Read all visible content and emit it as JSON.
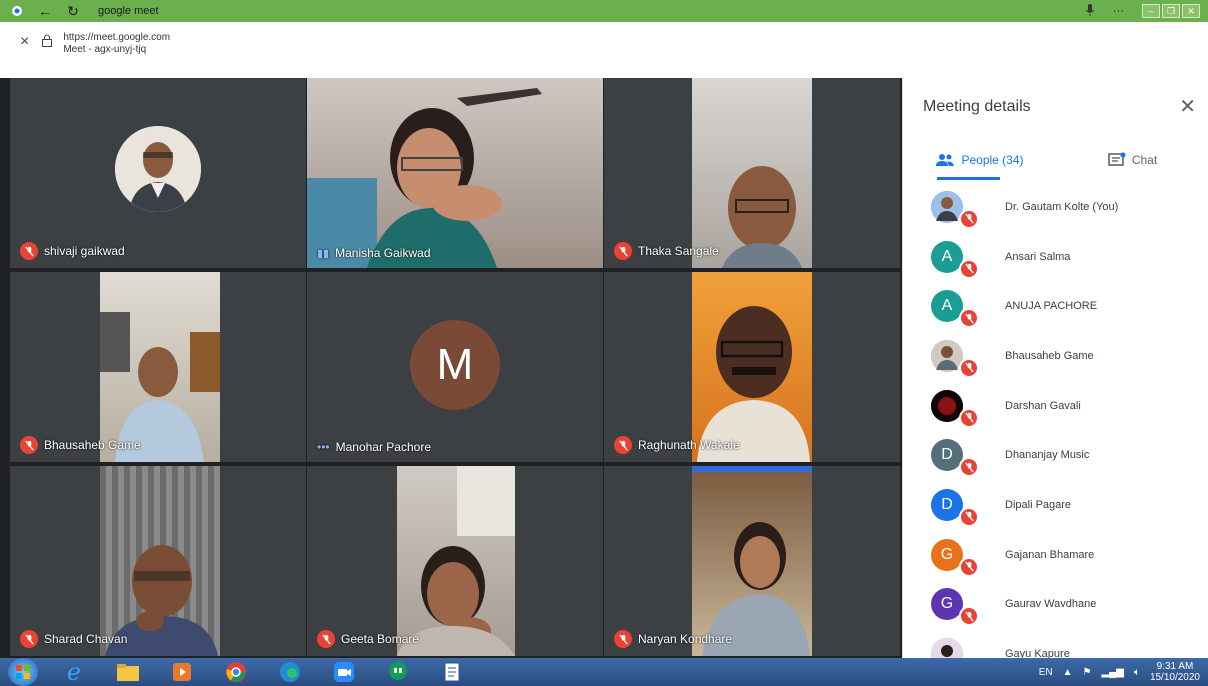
{
  "browser": {
    "title": "google meet",
    "url": "https://meet.google.com",
    "page_subtitle": "Meet - agx-unyj-tjq"
  },
  "tiles": [
    {
      "name": "shivaji gaikwad",
      "state": "muted"
    },
    {
      "name": "Manisha Gaikwad",
      "state": "speaking"
    },
    {
      "name": "Thaka Sangale",
      "state": "muted"
    },
    {
      "name": "Bhausaheb Game",
      "state": "muted"
    },
    {
      "name": "Manohar Pachore",
      "state": "more",
      "avatar_letter": "M"
    },
    {
      "name": "Raghunath Wakale",
      "state": "muted"
    },
    {
      "name": "Sharad Chavan",
      "state": "muted"
    },
    {
      "name": "Geeta Bomare",
      "state": "muted"
    },
    {
      "name": "Naryan Kondhare",
      "state": "muted"
    }
  ],
  "panel": {
    "title": "Meeting details",
    "tab_people": "People (34)",
    "tab_chat": "Chat",
    "participants": [
      {
        "name": "Dr. Gautam Kolte (You)",
        "letter": "",
        "color": "#7aa7d8"
      },
      {
        "name": "Ansari Salma",
        "letter": "A",
        "color": "#1a9e94"
      },
      {
        "name": "ANUJA PACHORE",
        "letter": "A",
        "color": "#1a9e94"
      },
      {
        "name": "Bhausaheb Game",
        "letter": "",
        "color": "#9a9a9a"
      },
      {
        "name": "Darshan Gavali",
        "letter": "",
        "color": "#5a0d10"
      },
      {
        "name": "Dhananjay Music",
        "letter": "D",
        "color": "#546e7a"
      },
      {
        "name": "Dipali Pagare",
        "letter": "D",
        "color": "#1a73e8"
      },
      {
        "name": "Gajanan Bhamare",
        "letter": "G",
        "color": "#e8711a"
      },
      {
        "name": "Gaurav Wavdhane",
        "letter": "G",
        "color": "#5e35b1"
      },
      {
        "name": "Gayu Kapure",
        "letter": "",
        "color": "#b08ab8"
      }
    ]
  },
  "taskbar": {
    "lang": "EN",
    "time": "9:31 AM",
    "date": "15/10/2020"
  },
  "colors": {
    "accent": "#1a73e8",
    "muted": "#ea4335",
    "titlebar": "#6ab04c"
  }
}
